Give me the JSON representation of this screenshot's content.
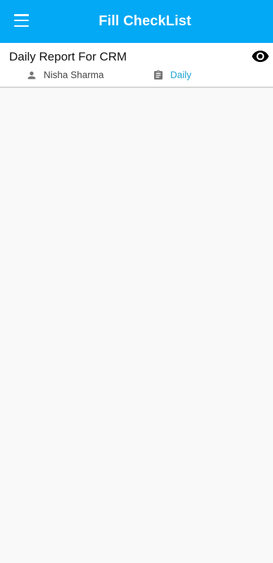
{
  "appbar": {
    "title": "Fill CheckList",
    "menu_icon": "menu-icon",
    "background": "#03a9f4"
  },
  "checklist": {
    "title": "Daily Report For CRM",
    "view_icon": "eye-icon",
    "user_icon": "person-icon",
    "user": "Nisha Sharma",
    "frequency_icon": "clipboard-icon",
    "frequency": "Daily",
    "frequency_color": "#1fa3d1"
  }
}
